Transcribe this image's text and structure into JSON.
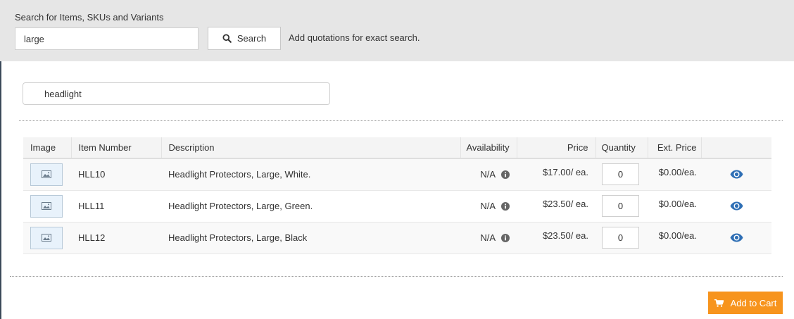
{
  "search": {
    "label": "Search for Items, SKUs and Variants",
    "value": "large",
    "button_label": "Search",
    "hint": "Add quotations for exact search."
  },
  "filter": {
    "value": "headlight"
  },
  "table": {
    "headers": {
      "image": "Image",
      "item_number": "Item Number",
      "description": "Description",
      "availability": "Availability",
      "price": "Price",
      "quantity": "Quantity",
      "ext_price": "Ext. Price"
    },
    "rows": [
      {
        "item_number": "HLL10",
        "description": "Headlight Protectors, Large, White.",
        "availability": "N/A",
        "price": "$17.00/ ea.",
        "quantity": "0",
        "ext_price": "$0.00/ea."
      },
      {
        "item_number": "HLL11",
        "description": "Headlight Protectors, Large, Green.",
        "availability": "N/A",
        "price": "$23.50/ ea.",
        "quantity": "0",
        "ext_price": "$0.00/ea."
      },
      {
        "item_number": "HLL12",
        "description": "Headlight Protectors, Large, Black",
        "availability": "N/A",
        "price": "$23.50/ ea.",
        "quantity": "0",
        "ext_price": "$0.00/ea."
      }
    ]
  },
  "cart": {
    "button_label": "Add to Cart"
  },
  "icons": {
    "search": "search-icon",
    "image_placeholder": "image-placeholder-icon",
    "info": "info-icon",
    "view": "eye-icon",
    "cart": "cart-icon"
  },
  "colors": {
    "panel_bg": "#e6e6e6",
    "accent_orange": "#f7941d",
    "eye_blue": "#2f6fb5"
  }
}
